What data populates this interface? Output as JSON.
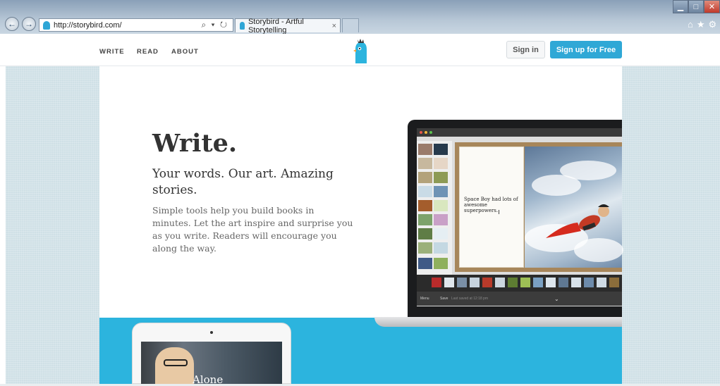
{
  "browser": {
    "url": "http://storybird.com/",
    "address_icons": "⌕ ▾ ↻",
    "tab_title": "Storybird - Artful Storytelling",
    "tab_close": "×",
    "right_icons": "⌂★⚙"
  },
  "nav": {
    "write": "WRITE",
    "read": "READ",
    "about": "ABOUT",
    "sign_in": "Sign in",
    "sign_up": "Sign up for Free"
  },
  "hero": {
    "headline": "Write.",
    "subhead": "Your words. Our art. Amazing stories.",
    "body": "Simple tools help you build books in minutes. Let the art inspire and surprise you as you write. Readers will encourage you along the way."
  },
  "laptop_screen": {
    "page_text": "Space Boy had lots of awesome superpowers.",
    "toolbar_menu": "Menu",
    "toolbar_save": "Save",
    "toolbar_status": "Last saved at 12:18 pm"
  },
  "tablet": {
    "book_title": "Alone"
  },
  "colors": {
    "brand_blue": "#2cb4de",
    "signup_button": "#2fa8d6"
  }
}
